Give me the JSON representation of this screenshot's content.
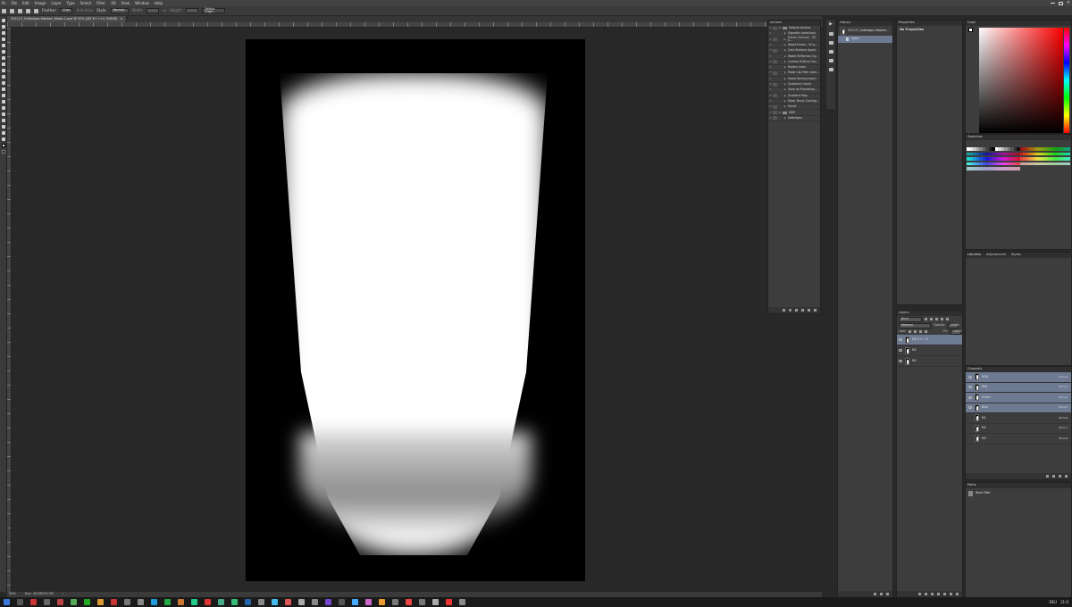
{
  "menu": [
    "Ps",
    "File",
    "Edit",
    "Image",
    "Layer",
    "Type",
    "Select",
    "Filter",
    "3D",
    "View",
    "Window",
    "Help"
  ],
  "window_controls": [
    "minimize",
    "maximize",
    "close"
  ],
  "options_bar": {
    "feather_label": "Feather:",
    "feather_value": "0 px",
    "antialias_label": "Anti-alias",
    "style_label": "Style:",
    "style_value": "Normal",
    "width_label": "Width:",
    "height_label": "Height:",
    "refine_button": "Refine Edge..."
  },
  "document": {
    "tab_title": "151117_Softedges-Masken_Mode-2.psd @ 50% (M2 K+++4, RGB/8)",
    "zoom": "50%",
    "doc_info": "Doc: 45,8M/79,3M"
  },
  "actions_panel": {
    "title": "Actions",
    "items": [
      {
        "label": "Default Actions",
        "type": "set"
      },
      {
        "label": "Vignette (selection)",
        "type": "action"
      },
      {
        "label": "Frame Channel - 50 p...",
        "type": "action"
      },
      {
        "label": "Wood Frame - 50 p...",
        "type": "action"
      },
      {
        "label": "Cast Shadow (type)",
        "type": "action"
      },
      {
        "label": "Water Reflection (ty...",
        "type": "action"
      },
      {
        "label": "Custom RGB to Gra...",
        "type": "action"
      },
      {
        "label": "Molten Lead",
        "type": "action"
      },
      {
        "label": "Make Clip Path (sele...",
        "type": "action"
      },
      {
        "label": "Sepia Toning (layer)",
        "type": "action"
      },
      {
        "label": "Quadrant Colors",
        "type": "action"
      },
      {
        "label": "Save as Photoshop ...",
        "type": "action"
      },
      {
        "label": "Gradient Map",
        "type": "action"
      },
      {
        "label": "Mixer Brush Cloning...",
        "type": "action"
      },
      {
        "label": "Smart",
        "type": "action"
      },
      {
        "label": "MKR",
        "type": "set"
      },
      {
        "label": "Softedges",
        "type": "action"
      }
    ]
  },
  "history_panel": {
    "title": "History",
    "snapshot": "151117_Softedges-Masken...",
    "states": [
      "Open"
    ]
  },
  "properties_panel": {
    "title": "Properties",
    "content": "No Properties"
  },
  "layers_panel": {
    "title": "Layers",
    "filter": "Kind",
    "blend_mode": "Normal",
    "opacity_label": "Opacity:",
    "opacity_value": "100%",
    "lock_label": "Lock:",
    "fill_label": "Fill:",
    "fill_value": "100%",
    "layers": [
      "M2 K+++4",
      "M2",
      "M1"
    ]
  },
  "color_panel": {
    "title": "Color"
  },
  "swatches_panel": {
    "title": "Swatches"
  },
  "libraries_panel": {
    "tabs": [
      "Libraries",
      "Adjustments",
      "Styles"
    ]
  },
  "channels_panel": {
    "title": "Channels",
    "channels": [
      {
        "name": "RGB",
        "shortcut": "Ctrl+2"
      },
      {
        "name": "Red",
        "shortcut": "Ctrl+3"
      },
      {
        "name": "Green",
        "shortcut": "Ctrl+4"
      },
      {
        "name": "Blue",
        "shortcut": "Ctrl+5"
      },
      {
        "name": "M1",
        "shortcut": "Ctrl+6"
      },
      {
        "name": "M2",
        "shortcut": "Ctrl+7"
      },
      {
        "name": "M3",
        "shortcut": "Ctrl+8"
      }
    ]
  },
  "paths_panel": {
    "title": "Paths",
    "paths": [
      "Work Path"
    ]
  },
  "taskbar": {
    "tray_lang": "DEU",
    "clock": "11:0"
  },
  "colors": {
    "accent_selected": "#6d7a92",
    "panel_bg": "#3d3d3d",
    "canvas_bg": "#282828"
  }
}
